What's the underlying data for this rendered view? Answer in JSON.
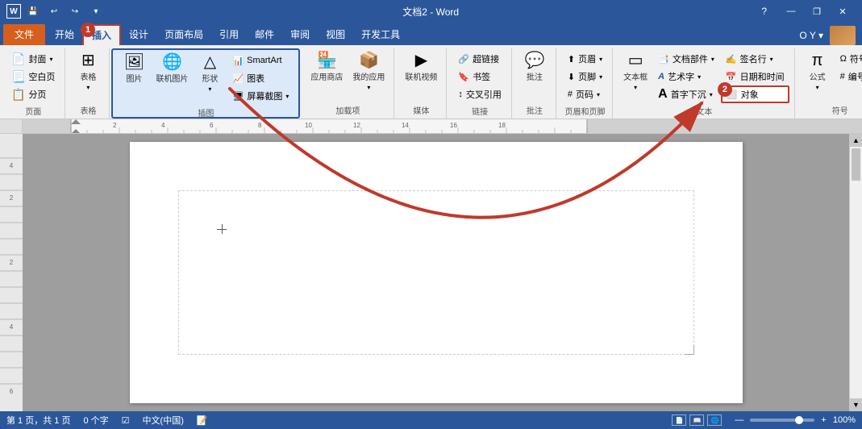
{
  "titleBar": {
    "title": "文档2 - Word",
    "wordIcon": "W",
    "helpBtn": "?",
    "winControls": [
      "—",
      "❐",
      "✕"
    ],
    "quickButtons": [
      "↩",
      "↪",
      "▸"
    ]
  },
  "ribbonTabs": {
    "file": "文件",
    "tabs": [
      "开始",
      "插入",
      "设计",
      "页面布局",
      "引用",
      "邮件",
      "审阅",
      "视图",
      "开发工具"
    ],
    "activeTab": "插入",
    "rightArea": "O Y ▾"
  },
  "ribbon": {
    "groups": [
      {
        "id": "pages",
        "label": "页面",
        "items": [
          {
            "label": "封面▾",
            "icon": "📄"
          },
          {
            "label": "空白页",
            "icon": "📃"
          },
          {
            "label": "分页",
            "icon": "📋"
          }
        ]
      },
      {
        "id": "tables",
        "label": "表格",
        "items": [
          {
            "label": "表格",
            "icon": "⊞"
          }
        ]
      },
      {
        "id": "illustrations",
        "label": "插图",
        "items": [
          {
            "label": "图片",
            "icon": "🖼"
          },
          {
            "label": "联机图片",
            "icon": "🌐"
          },
          {
            "label": "形状▾",
            "icon": "△"
          },
          {
            "label": "SmartArt",
            "icon": "📊"
          },
          {
            "label": "图表",
            "icon": "📈"
          },
          {
            "label": "屏幕截图▾",
            "icon": "🖥"
          }
        ]
      },
      {
        "id": "addons",
        "label": "加载项",
        "items": [
          {
            "label": "应用商店",
            "icon": "🏪"
          },
          {
            "label": "我的应用▾",
            "icon": "📦"
          }
        ]
      },
      {
        "id": "media",
        "label": "媒体",
        "items": [
          {
            "label": "联机视频",
            "icon": "▶"
          }
        ]
      },
      {
        "id": "links",
        "label": "链接",
        "items": [
          {
            "label": "超链接",
            "icon": "🔗"
          },
          {
            "label": "书签",
            "icon": "🔖"
          },
          {
            "label": "交叉引用",
            "icon": "↕"
          }
        ]
      },
      {
        "id": "comments",
        "label": "批注",
        "items": [
          {
            "label": "批注",
            "icon": "💬"
          }
        ]
      },
      {
        "id": "headerFooter",
        "label": "页眉和页脚",
        "items": [
          {
            "label": "页眉▾",
            "icon": "⬆"
          },
          {
            "label": "页脚▾",
            "icon": "⬇"
          },
          {
            "label": "页码▾",
            "icon": "#"
          }
        ]
      },
      {
        "id": "text",
        "label": "文本",
        "items": [
          {
            "label": "文本框",
            "icon": "▭"
          },
          {
            "label": "文档部件▾",
            "icon": "📑"
          },
          {
            "label": "艺术字▾",
            "icon": "A"
          },
          {
            "label": "首字下沉▾",
            "icon": "A"
          },
          {
            "label": "签名行▾",
            "icon": "✍"
          },
          {
            "label": "日期和时间",
            "icon": "📅"
          },
          {
            "label": "对象",
            "icon": "⬜"
          }
        ]
      },
      {
        "id": "symbols",
        "label": "符号",
        "items": [
          {
            "label": "公式▾",
            "icon": "π"
          },
          {
            "label": "符号▾",
            "icon": "Ω"
          },
          {
            "label": "编号",
            "icon": "#"
          }
        ]
      }
    ]
  },
  "statusBar": {
    "page": "第 1 页，共 1 页",
    "words": "0 个字",
    "lang": "中文(中国)",
    "zoom": "100%",
    "viewMode": "📄"
  },
  "badges": {
    "insert": "1",
    "object": "2"
  }
}
